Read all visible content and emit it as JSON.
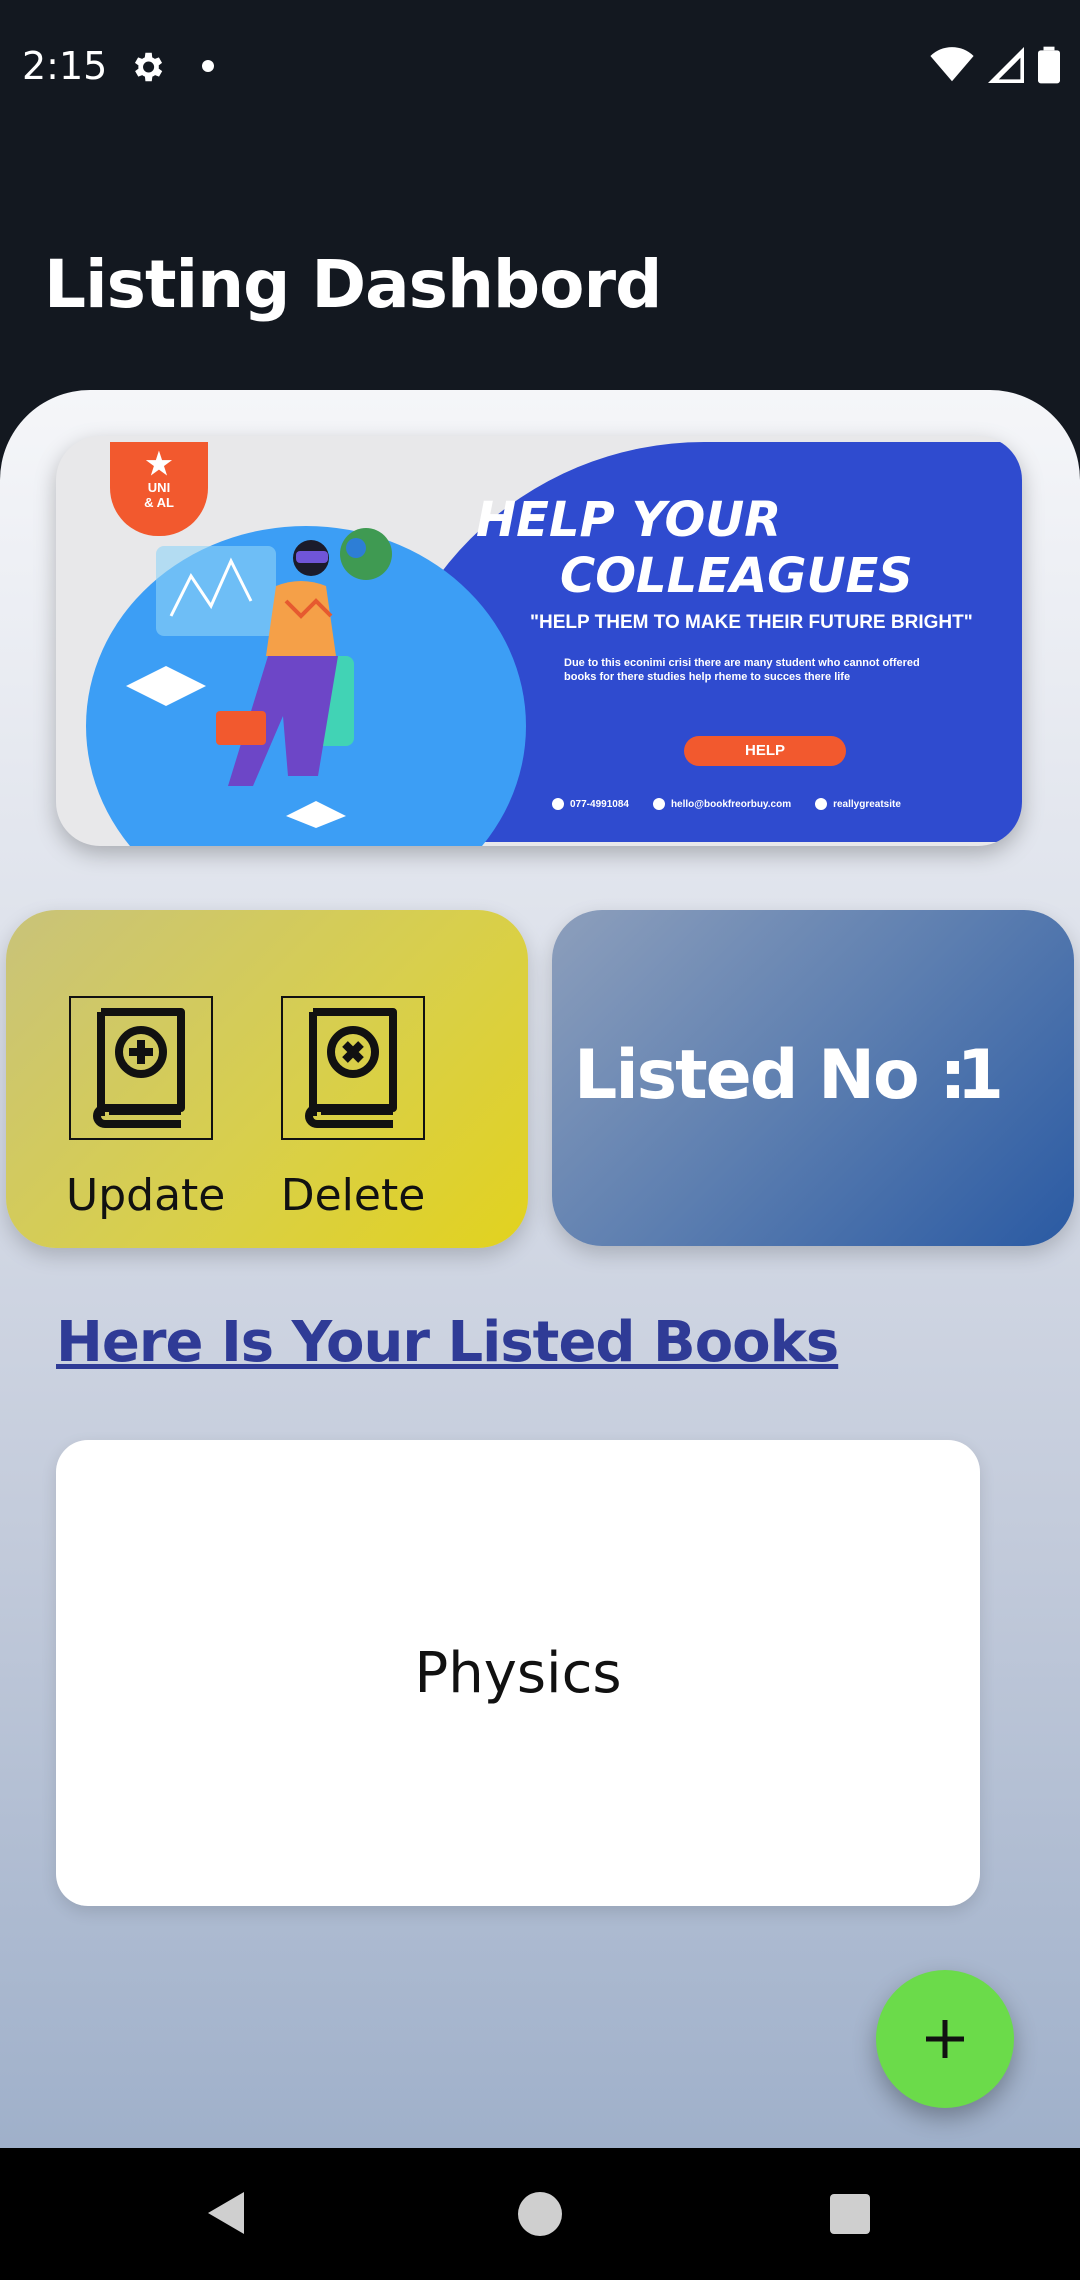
{
  "status_bar": {
    "time": "2:15",
    "icons": [
      "gear-icon",
      "dot-icon",
      "wifi-icon",
      "signal-icon",
      "battery-icon"
    ]
  },
  "header": {
    "title": "Listing Dashbord"
  },
  "banner": {
    "badge_line1": "UNI",
    "badge_line2": "& AL",
    "headline_line1": "HELP YOUR",
    "headline_line2": "COLLEAGUES",
    "quote": "\"HELP THEM TO MAKE THEIR FUTURE BRIGHT\"",
    "body": "Due to this econimi crisi there  are many student who cannot offered books for there studies help rheme to succes there life",
    "help_label": "HELP",
    "phone": "077-4991084",
    "email": "hello@bookfreorbuy.com",
    "site": "reallygreatsite",
    "colors": {
      "blue": "#2f4bcf",
      "orange": "#f2592e",
      "circle": "#3c9ef5"
    }
  },
  "actions": {
    "update_label": "Update",
    "delete_label": "Delete",
    "update_icon": "book-plus-icon",
    "delete_icon": "book-x-icon"
  },
  "stats": {
    "label": "Listed No :",
    "value": "1"
  },
  "books_section": {
    "heading": "Here Is Your Listed Books",
    "items": [
      {
        "title": "Physics"
      }
    ]
  },
  "fab": {
    "icon": "plus-icon",
    "color": "#6bdb4a"
  },
  "nav": {
    "icons": [
      "back-icon",
      "home-icon",
      "recents-icon"
    ]
  }
}
